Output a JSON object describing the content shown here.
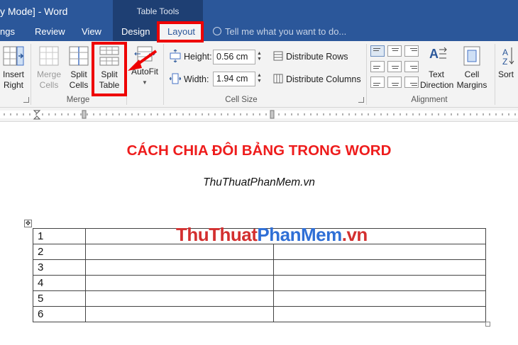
{
  "window": {
    "title": "y Mode] - Word",
    "context_group": "Table Tools"
  },
  "tabs": {
    "left_partial": "ngs",
    "review": "Review",
    "view": "View",
    "design": "Design",
    "layout": "Layout"
  },
  "tellme": {
    "placeholder": "Tell me what you want to do..."
  },
  "ribbon": {
    "insert_right": [
      "Insert",
      "Right"
    ],
    "merge_cells": [
      "Merge",
      "Cells"
    ],
    "split_cells": [
      "Split",
      "Cells"
    ],
    "split_table": [
      "Split",
      "Table"
    ],
    "autofit": "AutoFit",
    "merge_group": "Merge",
    "height_label": "Height:",
    "height_value": "0.56 cm",
    "width_label": "Width:",
    "width_value": "1.94 cm",
    "distribute_rows": "Distribute Rows",
    "distribute_columns": "Distribute Columns",
    "cell_size_group": "Cell Size",
    "text_direction": [
      "Text",
      "Direction"
    ],
    "cell_margins": [
      "Cell",
      "Margins"
    ],
    "alignment_group": "Alignment",
    "sort": "Sort"
  },
  "document": {
    "title": "CÁCH CHIA ĐÔI BẢNG TRONG WORD",
    "subtitle": "ThuThuatPhanMem.vn",
    "rows": [
      "1",
      "2",
      "3",
      "4",
      "5",
      "6"
    ]
  },
  "watermark": {
    "part1": "ThuThuat",
    "part2": "PhanMem",
    "part3": ".vn"
  },
  "colors": {
    "ribbon_blue": "#2b579a",
    "highlight_red": "#ee0000",
    "title_red": "#ee1c1c"
  }
}
